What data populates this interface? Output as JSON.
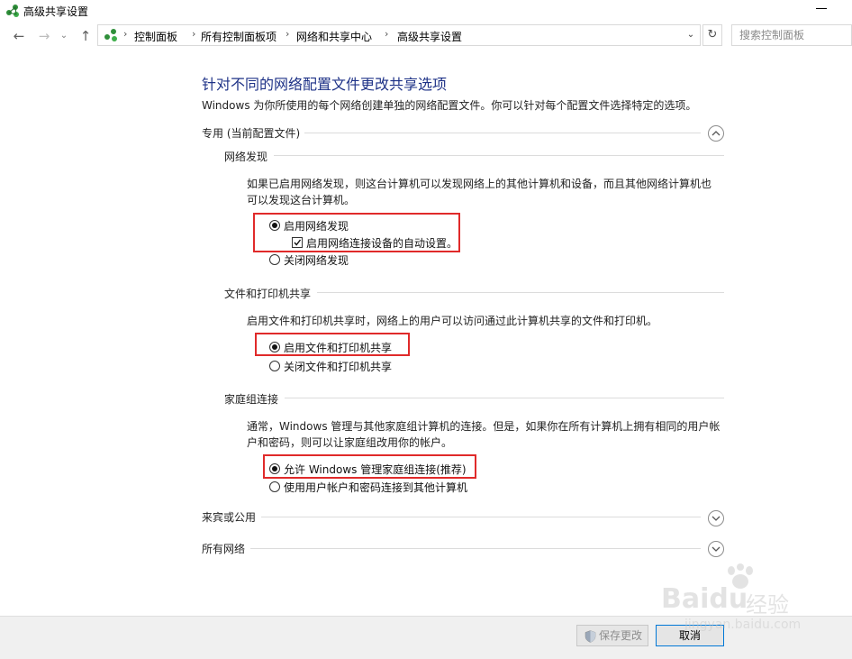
{
  "window": {
    "title": "高级共享设置"
  },
  "breadcrumb": [
    "控制面板",
    "所有控制面板项",
    "网络和共享中心",
    "高级共享设置"
  ],
  "search": {
    "placeholder": "搜索控制面板"
  },
  "main": {
    "title": "针对不同的网络配置文件更改共享选项",
    "description": "Windows 为你所使用的每个网络创建单独的网络配置文件。你可以针对每个配置文件选择特定的选项。",
    "private_profile": {
      "label": "专用 (当前配置文件)",
      "expanded": true,
      "network_discovery": {
        "heading": "网络发现",
        "desc_line1": "如果已启用网络发现，则这台计算机可以发现网络上的其他计算机和设备，而且其他网络计算机也",
        "desc_line2": "可以发现这台计算机。",
        "options": [
          "启用网络发现",
          "关闭网络发现"
        ],
        "selected": 0,
        "auto_setup_label": "启用网络连接设备的自动设置。",
        "auto_setup_checked": true
      },
      "file_printer_sharing": {
        "heading": "文件和打印机共享",
        "desc": "启用文件和打印机共享时，网络上的用户可以访问通过此计算机共享的文件和打印机。",
        "options": [
          "启用文件和打印机共享",
          "关闭文件和打印机共享"
        ],
        "selected": 0
      },
      "homegroup": {
        "heading": "家庭组连接",
        "desc_line1": "通常，Windows 管理与其他家庭组计算机的连接。但是，如果你在所有计算机上拥有相同的用户帐",
        "desc_line2": "户和密码，则可以让家庭组改用你的帐户。",
        "options": [
          "允许 Windows 管理家庭组连接(推荐)",
          "使用用户帐户和密码连接到其他计算机"
        ],
        "selected": 0
      }
    },
    "guest_public": {
      "label": "来宾或公用",
      "expanded": false
    },
    "all_networks": {
      "label": "所有网络",
      "expanded": false
    }
  },
  "footer": {
    "save_label": "保存更改",
    "save_enabled": false,
    "cancel_label": "取消"
  },
  "watermark": {
    "logo": "Baidu",
    "cn": "经验",
    "url": "jingyan.baidu.com"
  },
  "colors": {
    "title": "#1e3287",
    "highlight_box": "#e02a2a",
    "focus_border": "#0078d7"
  }
}
